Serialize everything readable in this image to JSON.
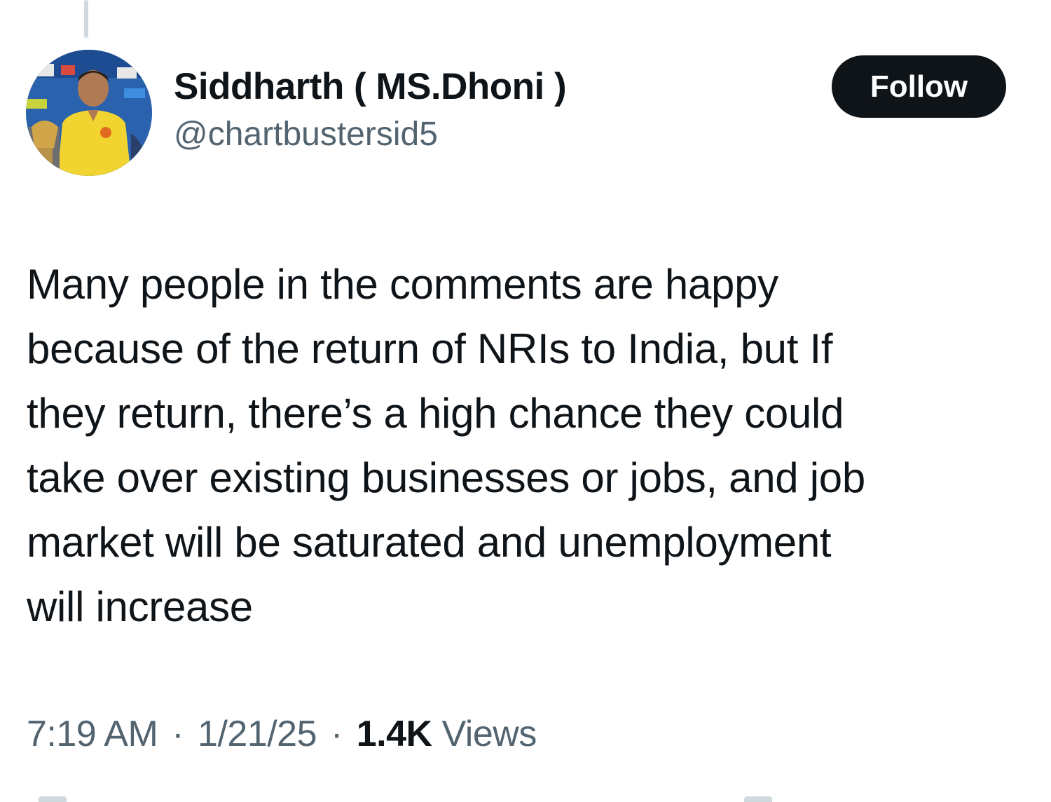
{
  "tweet": {
    "author": {
      "display_name": "Siddharth ( MS.Dhoni )",
      "handle": "@chartbustersid5",
      "avatar_icon": "profile-photo"
    },
    "follow_label": "Follow",
    "text": "Many people in the comments are happy\nbecause of the return of NRIs to India, but If\nthey return, there’s a high chance they could\ntake over existing businesses or jobs, and job\nmarket will be saturated and unemployment\nwill increase",
    "meta": {
      "time": "7:19 AM",
      "separator": "·",
      "date": "1/21/25",
      "views_count": "1.4K",
      "views_label": "Views"
    }
  },
  "colors": {
    "text_primary": "#0f1419",
    "text_secondary": "#536471",
    "follow_button_bg": "#0f1419",
    "follow_button_text": "#ffffff",
    "thread_line": "#cfd9de"
  }
}
